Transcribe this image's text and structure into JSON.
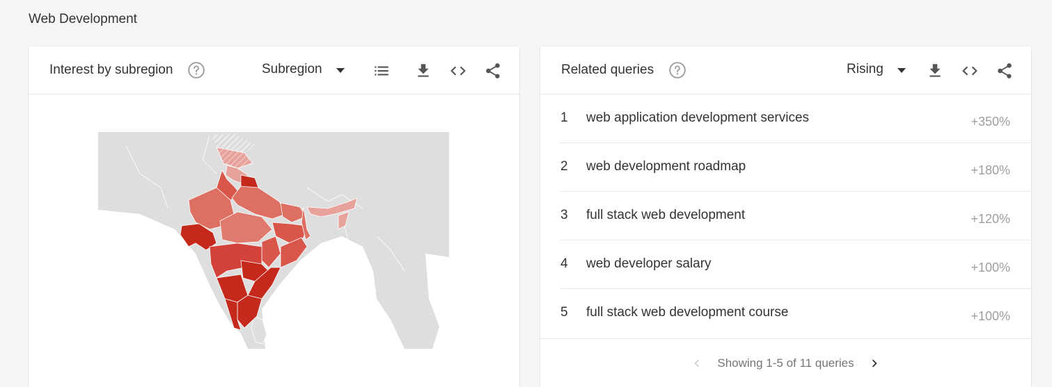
{
  "page": {
    "title": "Web Development"
  },
  "subregion_card": {
    "title": "Interest by subregion",
    "help_icon": "help-circle-icon",
    "dropdown_value": "Subregion",
    "tools": [
      "list-icon",
      "download-icon",
      "embed-code-icon",
      "share-icon"
    ]
  },
  "queries_card": {
    "title": "Related queries",
    "help_icon": "help-circle-icon",
    "dropdown_value": "Rising",
    "tools": [
      "download-icon",
      "embed-code-icon",
      "share-icon"
    ],
    "rows": [
      {
        "rank": "1",
        "query": "web application development services",
        "value": "+350%"
      },
      {
        "rank": "2",
        "query": "web development roadmap",
        "value": "+180%"
      },
      {
        "rank": "3",
        "query": "full stack web development",
        "value": "+120%"
      },
      {
        "rank": "4",
        "query": "web developer salary",
        "value": "+100%"
      },
      {
        "rank": "5",
        "query": "full stack web development course",
        "value": "+100%"
      }
    ],
    "pagination": {
      "text": "Showing 1-5 of 11 queries",
      "prev_icon": "chevron-left-icon",
      "next_icon": "chevron-right-icon"
    }
  },
  "colors": {
    "map_land": "#dedede",
    "map_low": "#e8a29c",
    "map_mid": "#dd7063",
    "map_high": "#c5291c",
    "value_text": "#9e9e9e"
  }
}
